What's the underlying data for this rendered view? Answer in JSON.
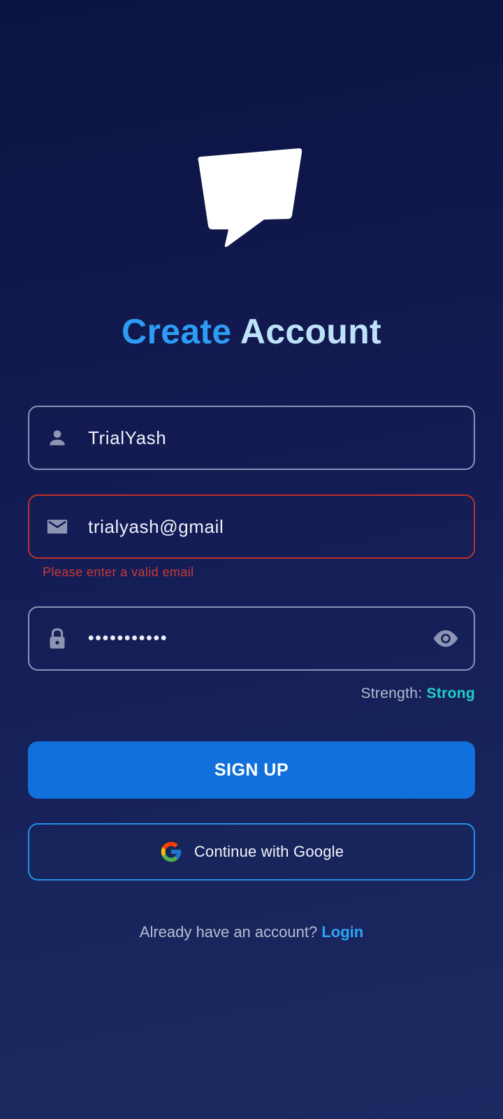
{
  "header": {
    "logo_icon": "speech-bubble-logo",
    "title_part1": "Create",
    "title_part2": "Account"
  },
  "form": {
    "username": {
      "icon": "person-icon",
      "value": "TrialYash"
    },
    "email": {
      "icon": "mail-icon",
      "value": "trialyash@gmail",
      "error": "Please enter a valid email",
      "error_color": "#c0302a"
    },
    "password": {
      "icon": "lock-icon",
      "value": "•••••••••••",
      "toggle_icon": "eye-icon"
    },
    "strength": {
      "label": "Strength:",
      "value": "Strong",
      "color": "#1fd1c8"
    }
  },
  "actions": {
    "signup_label": "SIGN UP",
    "google_label": "Continue with Google",
    "google_icon": "google-icon"
  },
  "footer": {
    "prompt": "Already have an account?",
    "login_label": "Login"
  },
  "colors": {
    "accent": "#1270dc",
    "title_primary": "#2d9cf4",
    "title_secondary": "#bfe2fb",
    "link": "#2ea2f8"
  }
}
